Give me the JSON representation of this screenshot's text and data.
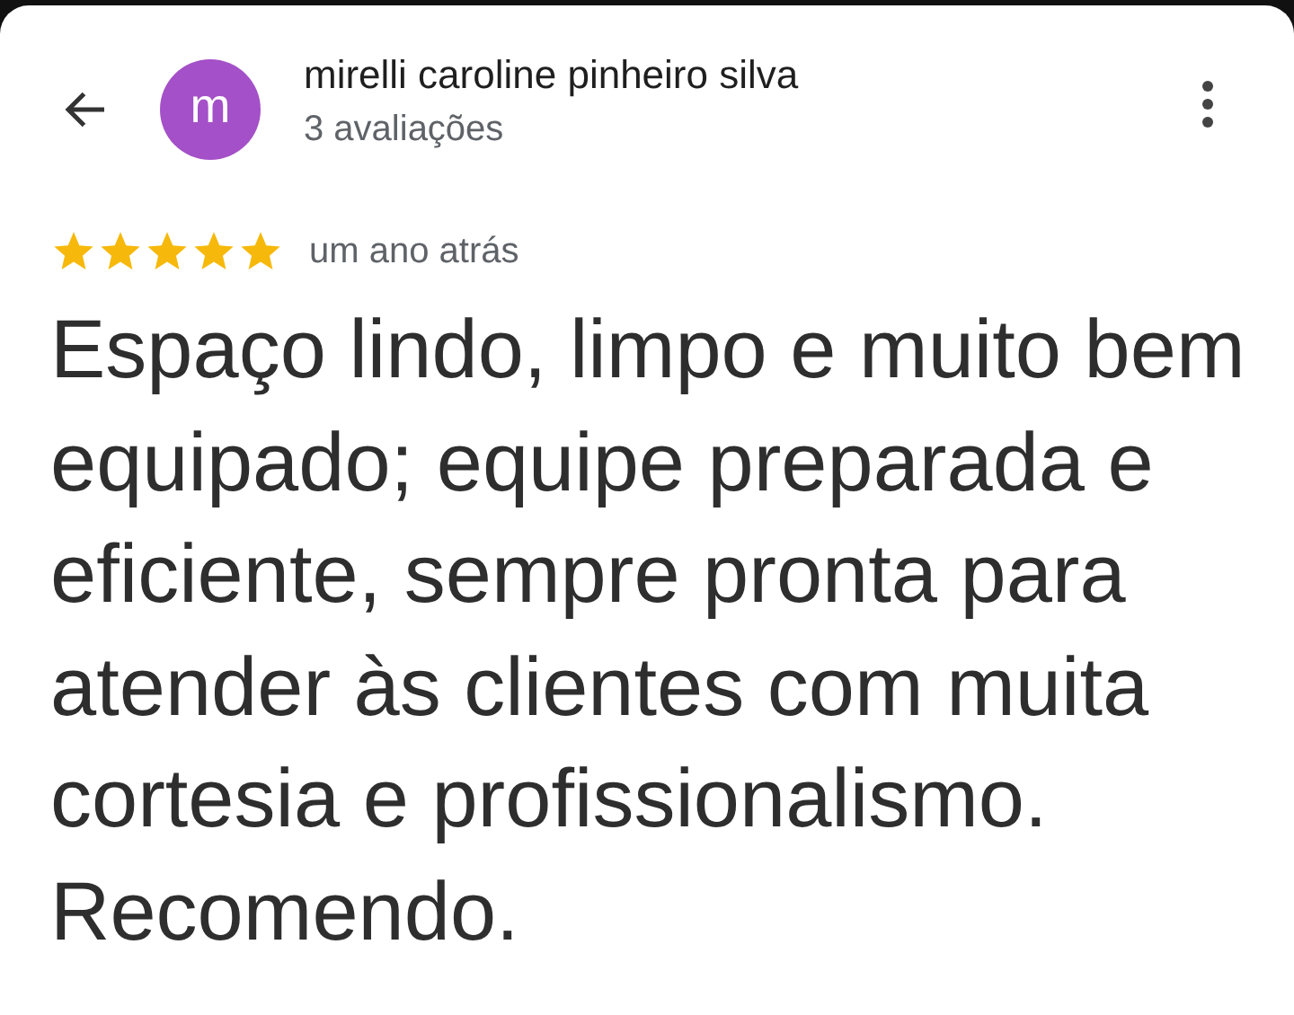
{
  "header": {
    "avatar_letter": "m",
    "name": "mirelli caroline pinheiro silva",
    "review_count": "3 avaliações"
  },
  "review": {
    "stars": 5,
    "time": "um ano atrás",
    "text": "Espaço lindo, limpo e muito bem equipado; equipe preparada e eficiente, sempre pronta para atender às clientes com muita cortesia e profissionalismo. Recomendo."
  }
}
